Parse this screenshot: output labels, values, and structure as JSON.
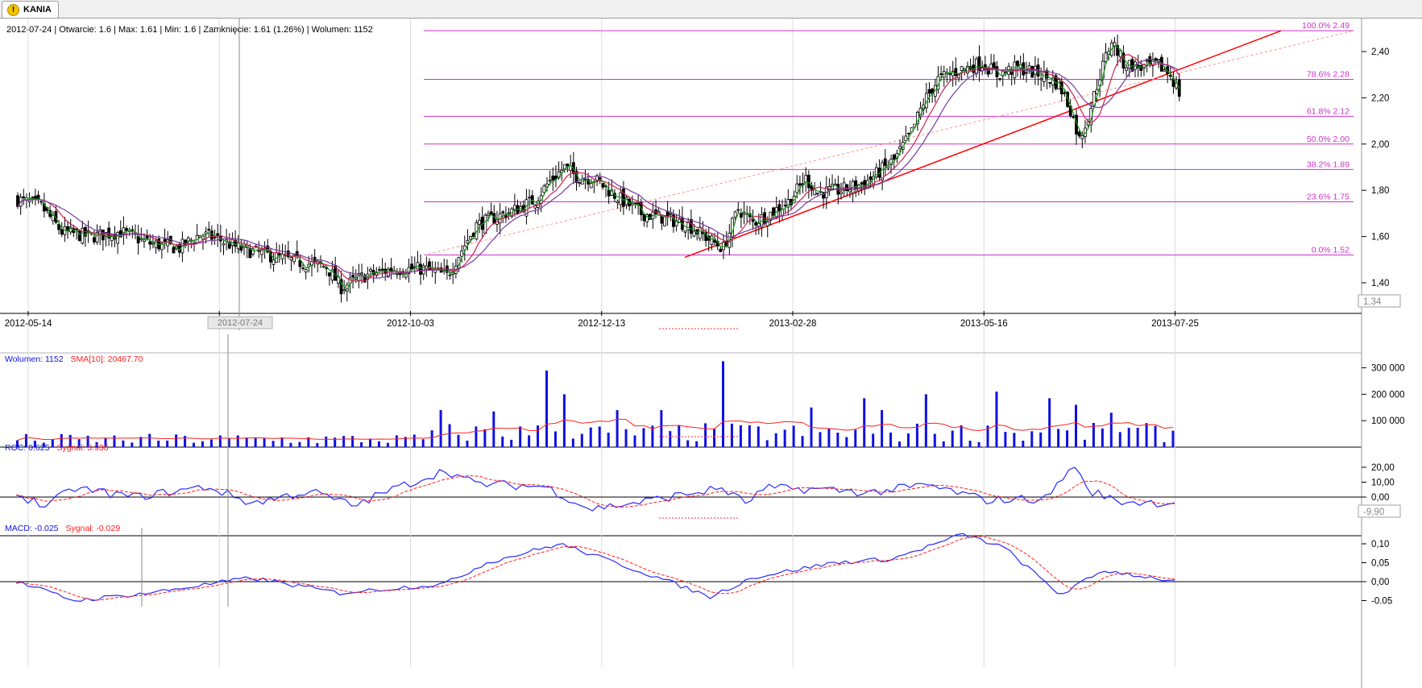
{
  "tab": {
    "label": "KANIA",
    "icon": "warning-icon"
  },
  "info_bar": "2012-07-24 | Otwarcie: 1.6 | Max: 1.61 | Min: 1.6 | Zamknięcie: 1.61 (1.26%) | Wolumen: 1152",
  "cursor_date_label": "2012-07-24",
  "last_price_label": "1,34",
  "roc_value_label": "-9,90",
  "x_tick_labels": [
    "2012-05-14",
    "2012-07-24",
    "2012-10-03",
    "2012-12-13",
    "2013-02-28",
    "2013-05-16",
    "2013-07-25"
  ],
  "colors": {
    "candle": "#000000",
    "ma_green": "#1a9a1a",
    "ma_red": "#cc2255",
    "ma_purple": "#7a3aa0",
    "fib": "#cc33cc",
    "trend": "#ff0000",
    "volume": "#1010e0",
    "roc": "#2a2aff",
    "signal": "#ff2020"
  },
  "chart_data": [
    {
      "type": "candlestick",
      "panel": "price",
      "title": "",
      "y_ticks": [
        "2,40",
        "2,20",
        "2,00",
        "1,80",
        "1,60",
        "1,40"
      ],
      "ylim": [
        1.3,
        2.5
      ],
      "x_ticks": [
        "2012-05-14",
        "2012-07-24",
        "2012-10-03",
        "2012-12-13",
        "2013-02-28",
        "2013-05-16",
        "2013-07-25"
      ],
      "close_path": [
        [
          0,
          1.76
        ],
        [
          8,
          1.73
        ],
        [
          15,
          1.62
        ],
        [
          25,
          1.6
        ],
        [
          35,
          1.62
        ],
        [
          45,
          1.57
        ],
        [
          55,
          1.55
        ],
        [
          62,
          1.61
        ],
        [
          68,
          1.59
        ],
        [
          75,
          1.55
        ],
        [
          85,
          1.52
        ],
        [
          95,
          1.49
        ],
        [
          105,
          1.47
        ],
        [
          110,
          1.38
        ],
        [
          118,
          1.43
        ],
        [
          128,
          1.46
        ],
        [
          138,
          1.46
        ],
        [
          146,
          1.43
        ],
        [
          150,
          1.52
        ],
        [
          156,
          1.65
        ],
        [
          162,
          1.68
        ],
        [
          170,
          1.72
        ],
        [
          176,
          1.76
        ],
        [
          181,
          1.84
        ],
        [
          186,
          1.9
        ],
        [
          190,
          1.86
        ],
        [
          196,
          1.85
        ],
        [
          204,
          1.77
        ],
        [
          212,
          1.7
        ],
        [
          220,
          1.68
        ],
        [
          228,
          1.65
        ],
        [
          236,
          1.58
        ],
        [
          240,
          1.55
        ],
        [
          245,
          1.72
        ],
        [
          250,
          1.66
        ],
        [
          256,
          1.7
        ],
        [
          262,
          1.75
        ],
        [
          268,
          1.85
        ],
        [
          272,
          1.79
        ],
        [
          280,
          1.8
        ],
        [
          288,
          1.83
        ],
        [
          292,
          1.87
        ],
        [
          298,
          1.93
        ],
        [
          304,
          2.05
        ],
        [
          308,
          2.18
        ],
        [
          313,
          2.28
        ],
        [
          320,
          2.32
        ],
        [
          328,
          2.35
        ],
        [
          333,
          2.3
        ],
        [
          340,
          2.33
        ],
        [
          348,
          2.3
        ],
        [
          354,
          2.26
        ],
        [
          358,
          2.15
        ],
        [
          361,
          2.02
        ],
        [
          364,
          2.12
        ],
        [
          368,
          2.3
        ],
        [
          372,
          2.45
        ],
        [
          376,
          2.35
        ],
        [
          382,
          2.33
        ],
        [
          388,
          2.34
        ],
        [
          392,
          2.3
        ],
        [
          395,
          2.22
        ]
      ],
      "moving_averages": [
        "green",
        "red",
        "purple"
      ],
      "fibonacci_levels": [
        {
          "label": "100.0% 2.49",
          "value": 2.49
        },
        {
          "label": "78.6% 2.28",
          "value": 2.28
        },
        {
          "label": "61.8% 2.12",
          "value": 2.12
        },
        {
          "label": "50.0% 2.00",
          "value": 2.0
        },
        {
          "label": "38.2% 1.89",
          "value": 1.89
        },
        {
          "label": "23.6% 1.75",
          "value": 1.75
        },
        {
          "label": "0.0% 1.52",
          "value": 1.52
        }
      ],
      "trendline": {
        "from": [
          236,
          1.52
        ],
        "to": [
          446,
          2.48
        ]
      },
      "dashed_trendline": {
        "from": [
          146,
          1.52
        ],
        "to": [
          446,
          2.49
        ]
      }
    },
    {
      "type": "bar",
      "panel": "volume",
      "legend": [
        {
          "text": "Wolumen: 1152",
          "color": "#1010e0"
        },
        {
          "text": "SMA[10]: 20467.70",
          "color": "#ff2020"
        }
      ],
      "y_ticks": [
        "300 000",
        "200 000",
        "100 000"
      ],
      "ylim": [
        0,
        340000
      ],
      "spikes": [
        [
          180,
          290000
        ],
        [
          240,
          325000
        ],
        [
          186,
          200000
        ],
        [
          352,
          185000
        ],
        [
          287,
          185000
        ],
        [
          270,
          150000
        ],
        [
          308,
          200000
        ],
        [
          333,
          210000
        ],
        [
          360,
          160000
        ],
        [
          372,
          130000
        ],
        [
          145,
          140000
        ],
        [
          163,
          135000
        ],
        [
          205,
          140000
        ],
        [
          219,
          140000
        ],
        [
          295,
          140000
        ]
      ],
      "base_volume": 30000,
      "sma_level": 55000
    },
    {
      "type": "line",
      "panel": "roc",
      "legend": [
        {
          "text": "ROC: 0.625",
          "color": "#2a2aff"
        },
        {
          "text": "Sygnał: 3.936",
          "color": "#ff2020"
        }
      ],
      "y_ticks": [
        "20,00",
        "10,00",
        "0,00",
        "-9,90"
      ],
      "ylim": [
        -14,
        26
      ],
      "key_points": [
        [
          0,
          2
        ],
        [
          10,
          -6
        ],
        [
          20,
          6
        ],
        [
          40,
          0
        ],
        [
          65,
          7
        ],
        [
          80,
          -4
        ],
        [
          100,
          4
        ],
        [
          115,
          -6
        ],
        [
          125,
          3
        ],
        [
          146,
          18
        ],
        [
          156,
          9
        ],
        [
          180,
          7
        ],
        [
          195,
          -8
        ],
        [
          210,
          -4
        ],
        [
          240,
          6
        ],
        [
          248,
          -4
        ],
        [
          255,
          6
        ],
        [
          276,
          5
        ],
        [
          290,
          3
        ],
        [
          310,
          8
        ],
        [
          330,
          -2
        ],
        [
          350,
          -1
        ],
        [
          360,
          22
        ],
        [
          364,
          5
        ],
        [
          375,
          -3
        ],
        [
          395,
          -4
        ]
      ]
    },
    {
      "type": "line",
      "panel": "macd",
      "legend": [
        {
          "text": "MACD: -0.025",
          "color": "#2a2aff"
        },
        {
          "text": "Sygnał: -0.029",
          "color": "#ff2020"
        }
      ],
      "y_ticks": [
        "0,10",
        "0,05",
        "0,00",
        "-0.05"
      ],
      "ylim": [
        -0.07,
        0.14
      ],
      "key_points": [
        [
          0,
          0.0
        ],
        [
          20,
          -0.05
        ],
        [
          45,
          -0.03
        ],
        [
          80,
          0.01
        ],
        [
          110,
          -0.03
        ],
        [
          146,
          -0.005
        ],
        [
          160,
          0.05
        ],
        [
          185,
          0.1
        ],
        [
          215,
          0.02
        ],
        [
          236,
          -0.04
        ],
        [
          250,
          0.01
        ],
        [
          278,
          0.05
        ],
        [
          298,
          0.06
        ],
        [
          322,
          0.125
        ],
        [
          336,
          0.09
        ],
        [
          355,
          -0.035
        ],
        [
          370,
          0.03
        ],
        [
          395,
          0.0
        ]
      ]
    }
  ]
}
